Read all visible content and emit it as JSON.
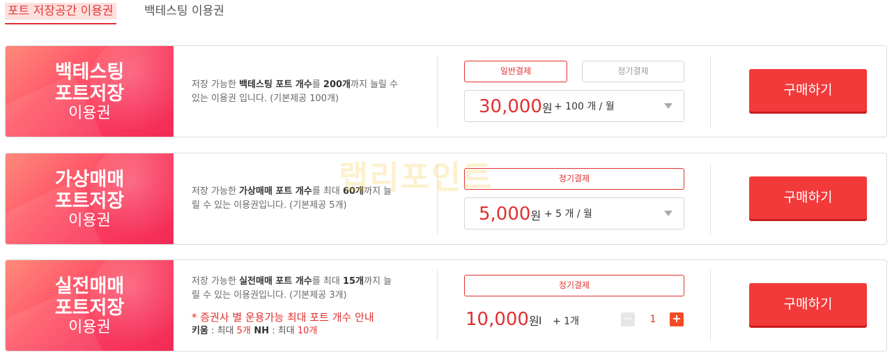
{
  "tabs": [
    {
      "label": "포트 저장공간 이용권",
      "active": true
    },
    {
      "label": "백테스팅 이용권",
      "active": false
    }
  ],
  "watermark": "랩리포인트",
  "cards": [
    {
      "title_l1": "백테스팅",
      "title_l2": "포트저장",
      "subtitle": "이용권",
      "desc": {
        "t1": "저장 가능한 ",
        "b1": "백테스팅 포트 개수",
        "t2": "를 ",
        "b2": "200개",
        "t3": "까지 늘릴 수",
        "line2": "있는 이용권 입니다. (기본제공 100개)"
      },
      "pay_options": [
        "일반결제",
        "정기결제"
      ],
      "price": "30,000",
      "currency": "원",
      "qty_label": "+ 100 개 / 월",
      "buy_label": "구매하기"
    },
    {
      "title_l1": "가상매매",
      "title_l2": "포트저장",
      "subtitle": "이용권",
      "desc": {
        "t1": "저장 가능한 ",
        "b1": "가상매매 포트 개수",
        "t2": "를 최대 ",
        "b2": "60개",
        "t3": "까지 늘",
        "line2": "릴 수 있는 이용권입니다. (기본제공 5개)"
      },
      "pay_options": [
        "정기결제"
      ],
      "price": "5,000",
      "currency": "원",
      "qty_label": "+ 5 개 / 월",
      "buy_label": "구매하기"
    },
    {
      "title_l1": "실전매매",
      "title_l2": "포트저장",
      "subtitle": "이용권",
      "desc": {
        "t1": "저장 가능한 ",
        "b1": "실전매매 포트 개수",
        "t2": "를 최대 ",
        "b2": "15개",
        "t3": "까지 늘",
        "line2": "릴 수 있는 이용권입니다. (기본제공 3개)"
      },
      "notice": "* 증권사 별 운용가능 최대 포트 개수 안내",
      "brokers": {
        "k1": "키움",
        "t1": " : 최대 ",
        "v1": "5개",
        "k2": " NH",
        "t2": " : 최대 ",
        "v2": "10개"
      },
      "pay_options": [
        "정기결제"
      ],
      "price": "10,000",
      "currency": "원",
      "separator": "I",
      "qty_label": "+ 1개",
      "stepper": {
        "minus": "−",
        "value": "1",
        "plus": "+"
      },
      "buy_label": "구매하기"
    }
  ]
}
